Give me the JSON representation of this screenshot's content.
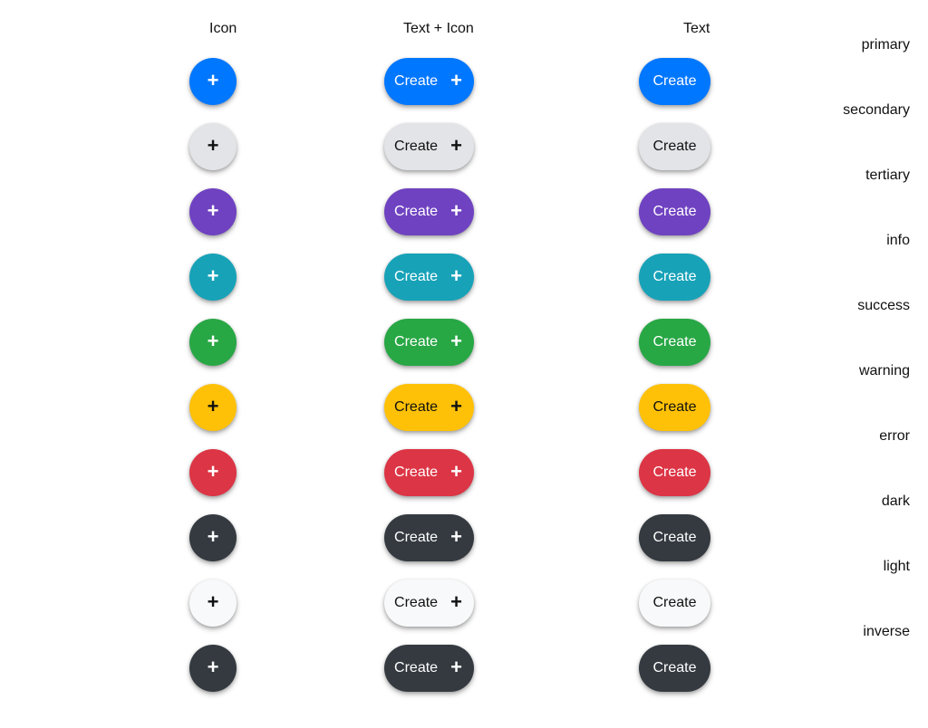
{
  "headers": {
    "icon": "Icon",
    "text_icon": "Text + Icon",
    "text": "Text"
  },
  "button_label": "Create",
  "icon_name": "plus-icon",
  "icon_glyph": "+",
  "variants": [
    {
      "name": "primary",
      "bg": "#0077ff",
      "fg": "#ffffff"
    },
    {
      "name": "secondary",
      "bg": "#e2e4e8",
      "fg": "#111111"
    },
    {
      "name": "tertiary",
      "bg": "#6f42c1",
      "fg": "#ffffff"
    },
    {
      "name": "info",
      "bg": "#17a2b8",
      "fg": "#ffffff"
    },
    {
      "name": "success",
      "bg": "#28a745",
      "fg": "#ffffff"
    },
    {
      "name": "warning",
      "bg": "#ffc107",
      "fg": "#111111"
    },
    {
      "name": "error",
      "bg": "#dc3545",
      "fg": "#ffffff"
    },
    {
      "name": "dark",
      "bg": "#343a40",
      "fg": "#ffffff"
    },
    {
      "name": "light",
      "bg": "#f8f9fa",
      "fg": "#111111"
    },
    {
      "name": "inverse",
      "bg": "#343a40",
      "fg": "#ffffff"
    }
  ]
}
